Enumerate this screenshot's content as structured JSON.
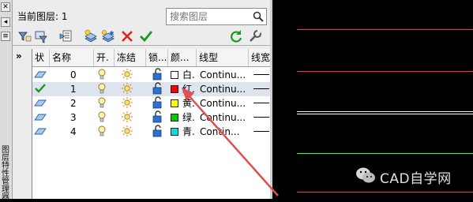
{
  "panel": {
    "current_layer_label": "当前图层: 1",
    "search_placeholder": "搜索图层",
    "strip_title": "图层特性管理器"
  },
  "toolbar": {
    "icons": [
      "new-property-filter-icon",
      "new-group-filter-icon",
      "layer-states-manager-icon",
      "new-layer-icon",
      "new-layer-vp-frozen-icon",
      "delete-layer-icon",
      "set-current-icon",
      "refresh-icon",
      "settings-icon"
    ]
  },
  "columns": {
    "status": "状",
    "name": "名称",
    "on": "开.",
    "freeze": "冻结",
    "lock": "锁...",
    "color": "颜...",
    "linetype": "线型",
    "lineweight": "线宽"
  },
  "layers": [
    {
      "name": "0",
      "color_name": "白",
      "color": "#ffffff",
      "linetype": "Continu...",
      "current": false
    },
    {
      "name": "1",
      "color_name": "红",
      "color": "#ff0000",
      "linetype": "Continu...",
      "current": true
    },
    {
      "name": "2",
      "color_name": "黄",
      "color": "#ffff00",
      "linetype": "Continu...",
      "current": false
    },
    {
      "name": "3",
      "color_name": "绿",
      "color": "#00cc00",
      "linetype": "Continu...",
      "current": false
    },
    {
      "name": "4",
      "color_name": "青",
      "color": "#00e0e0",
      "linetype": "Contin...",
      "current": false
    }
  ],
  "canvas": {
    "line_colors": [
      "#ff3030",
      "#ff3030",
      "#ffff80",
      "#ffffff",
      "#40ff40",
      "#ff3030"
    ]
  },
  "watermark": {
    "text": "CAD自学网"
  },
  "colors": {
    "accent_arrow": "#e05050",
    "selection": "#dde4ee"
  }
}
